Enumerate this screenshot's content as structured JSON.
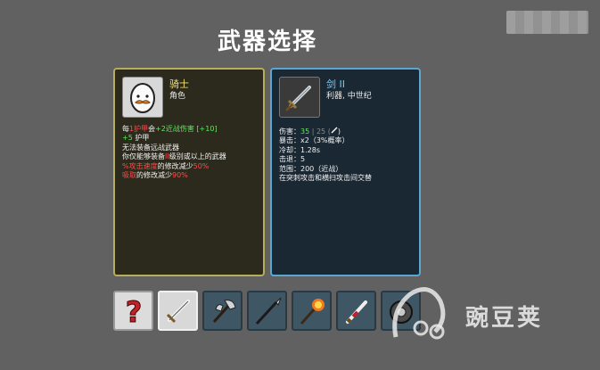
{
  "title": "武器选择",
  "character": {
    "name": "骑士",
    "type": "角色",
    "portrait_icon": "egg-mustache-icon",
    "lines": [
      {
        "a": "每",
        "b": "1护甲",
        "c": "会",
        "d": "+2近战伤害",
        "e": " [+10]"
      },
      {
        "a": "+5",
        "b": " 护甲"
      },
      {
        "a": "无法装备远战武器"
      },
      {
        "a": "你仅能够装备",
        "b": "II",
        "c": "级别或以上的武器"
      },
      {
        "a": "%攻击速度",
        "b": "的修改减少",
        "c": "50%"
      },
      {
        "a": "吸取",
        "b": "的修改减少",
        "c": "90%"
      }
    ]
  },
  "weapon": {
    "name": "剑 II",
    "tags": "利器, 中世纪",
    "icon": "sword-icon",
    "stats": [
      {
        "label": "伤害：",
        "value": "35",
        "extra": " | 25 (",
        "icon": "sword-small-icon",
        "close": ")"
      },
      {
        "label": "暴击：",
        "value": "x2（3%概率）"
      },
      {
        "label": "冷却：",
        "value": "1.28s"
      },
      {
        "label": "击退：",
        "value": "5"
      },
      {
        "label": "范围：",
        "value": "200（近战）"
      }
    ],
    "note": "在突刺攻击和横扫攻击间交替"
  },
  "weapon_slots": [
    {
      "name": "random-question-icon",
      "style": "light"
    },
    {
      "name": "sword-icon",
      "style": "sel"
    },
    {
      "name": "axe-icon",
      "style": "dark"
    },
    {
      "name": "spear-icon",
      "style": "dark"
    },
    {
      "name": "flame-torch-icon",
      "style": "dark"
    },
    {
      "name": "ornate-dagger-icon",
      "style": "dark"
    },
    {
      "name": "shield-icon",
      "style": "dark"
    }
  ],
  "watermark": {
    "text": "豌豆荚"
  },
  "colors": {
    "background": "#616161",
    "character_border": "#b6ae5a",
    "weapon_border": "#5aa7d4",
    "positive": "#5ee85e",
    "negative": "#ff4a4a"
  }
}
